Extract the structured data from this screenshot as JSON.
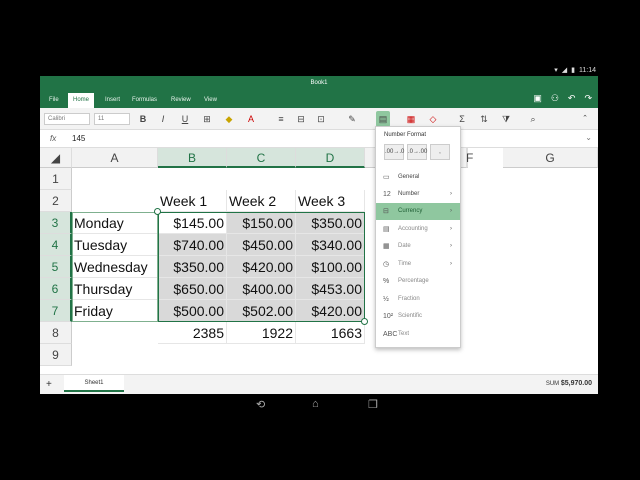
{
  "status": {
    "time": "11:14",
    "icons": [
      "wifi-icon",
      "signal-icon",
      "battery-icon"
    ]
  },
  "app": {
    "title": "Book1"
  },
  "tabs": [
    {
      "label": "File",
      "active": false
    },
    {
      "label": "Home",
      "active": true
    },
    {
      "label": "Insert",
      "active": false
    },
    {
      "label": "Formulas",
      "active": false
    },
    {
      "label": "Review",
      "active": false
    },
    {
      "label": "View",
      "active": false
    }
  ],
  "ribbon": {
    "font_name": "Calibri",
    "font_size": "11"
  },
  "formula": {
    "fx_label": "fx",
    "value": "145"
  },
  "columns": [
    "A",
    "B",
    "C",
    "D",
    "E",
    "F",
    "G"
  ],
  "rows": [
    "1",
    "2",
    "3",
    "4",
    "5",
    "6",
    "7",
    "8",
    "9"
  ],
  "cells": {
    "headers": [
      "Week 1",
      "Week 2",
      "Week 3"
    ],
    "days": [
      "Monday",
      "Tuesday",
      "Wednesday",
      "Thursday",
      "Friday"
    ],
    "values": [
      [
        "$145.00",
        "$150.00",
        "$350.00"
      ],
      [
        "$740.00",
        "$450.00",
        "$340.00"
      ],
      [
        "$350.00",
        "$420.00",
        "$100.00"
      ],
      [
        "$650.00",
        "$400.00",
        "$453.00"
      ],
      [
        "$500.00",
        "$502.00",
        "$420.00"
      ]
    ],
    "totals": [
      "2385",
      "1922",
      "1663"
    ]
  },
  "number_format": {
    "title": "Number Format",
    "buttons": [
      ".00→.0",
      ".0→.00",
      ","
    ],
    "items": [
      {
        "label": "General",
        "icon": "general-icon",
        "glyph": "▭",
        "arrow": false,
        "selected": false
      },
      {
        "label": "Number",
        "icon": "number-icon",
        "glyph": "12",
        "arrow": true,
        "selected": false
      },
      {
        "label": "Currency",
        "icon": "currency-icon",
        "glyph": "⊟",
        "arrow": true,
        "selected": true
      },
      {
        "label": "Accounting",
        "icon": "accounting-icon",
        "glyph": "▤",
        "arrow": true,
        "selected": false
      },
      {
        "label": "Date",
        "icon": "calendar-icon",
        "glyph": "▦",
        "arrow": true,
        "selected": false
      },
      {
        "label": "Time",
        "icon": "clock-icon",
        "glyph": "◷",
        "arrow": true,
        "selected": false
      },
      {
        "label": "Percentage",
        "icon": "percent-icon",
        "glyph": "%",
        "arrow": false,
        "selected": false
      },
      {
        "label": "Fraction",
        "icon": "fraction-icon",
        "glyph": "½",
        "arrow": false,
        "selected": false
      },
      {
        "label": "Scientific",
        "icon": "scientific-icon",
        "glyph": "10²",
        "arrow": false,
        "selected": false
      },
      {
        "label": "Text",
        "icon": "text-icon",
        "glyph": "ABC",
        "arrow": false,
        "selected": false
      }
    ]
  },
  "sheets": {
    "add_label": "+",
    "active": "Sheet1"
  },
  "statusbar": {
    "sum_label": "SUM",
    "sum_value": "$5,970.00"
  },
  "colors": {
    "accent": "#217346",
    "selected_menu": "#8fc79f"
  }
}
